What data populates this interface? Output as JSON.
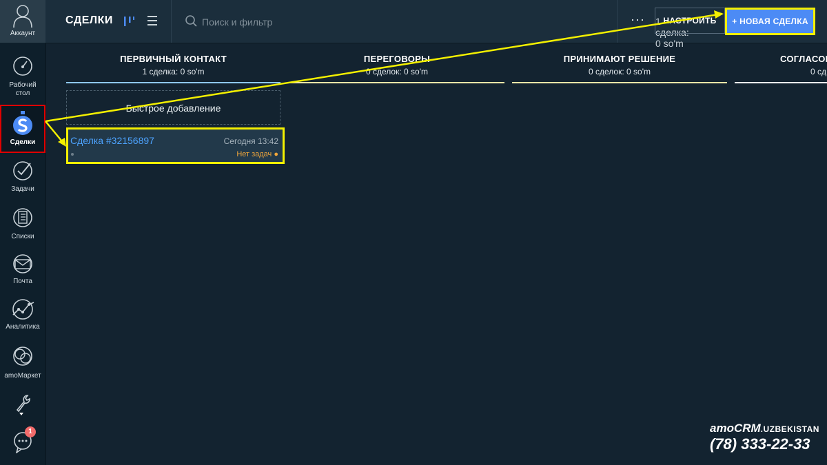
{
  "sidebar": {
    "account_label": "Аккаунт",
    "items": [
      {
        "label_lines": [
          "Рабочий",
          "стол"
        ],
        "icon": "dashboard-icon"
      },
      {
        "label_lines": [
          "Сделки"
        ],
        "icon": "deals-icon"
      },
      {
        "label_lines": [
          "Задачи"
        ],
        "icon": "tasks-icon"
      },
      {
        "label_lines": [
          "Списки"
        ],
        "icon": "lists-icon"
      },
      {
        "label_lines": [
          "Почта"
        ],
        "icon": "mail-icon"
      },
      {
        "label_lines": [
          "Аналитика"
        ],
        "icon": "analytics-icon"
      },
      {
        "label_lines": [
          "amoМаркет"
        ],
        "icon": "market-icon"
      },
      {
        "label_lines": [],
        "icon": "settings-wrench-icon"
      },
      {
        "label_lines": [],
        "icon": "chat-icon",
        "badge": "1"
      }
    ]
  },
  "topbar": {
    "title": "СДЕЛКИ",
    "search_placeholder": "Поиск и фильтр",
    "count": "1 сделка: 0 so'm",
    "more": "···",
    "config_label": "НАСТРОИТЬ",
    "new_deal_label": "+ НОВАЯ СДЕЛКА"
  },
  "columns": [
    {
      "name": "ПЕРВИЧНЫЙ КОНТАКТ",
      "sum": "1 сделка: 0 so'm",
      "color": "#8ec8f0"
    },
    {
      "name": "ПЕРЕГОВОРЫ",
      "sum": "0 сделок: 0 so'm",
      "color": "#f1e7a8"
    },
    {
      "name": "ПРИНИМАЮТ РЕШЕНИЕ",
      "sum": "0 сделок: 0 so'm",
      "color": "#f1e7a8"
    },
    {
      "name": "СОГЛАСОВ",
      "sum": "0 сд",
      "color": "#ffffff"
    }
  ],
  "quick_add_label": "Быстрое добавление",
  "deal": {
    "title": "Сделка #32156897",
    "time": "Сегодня 13:42",
    "tasks": "Нет задач ●"
  },
  "brand": {
    "logo_main": "amoCRM",
    "logo_suffix": ".UZBEKISTAN",
    "phone": "(78) 333-22-33"
  },
  "colors": {
    "accent_blue": "#4c8bf5",
    "highlight_yellow": "#f4f000",
    "highlight_red": "#e00000",
    "tasks_orange": "#f2a73b",
    "deal_link": "#4da3ff"
  }
}
